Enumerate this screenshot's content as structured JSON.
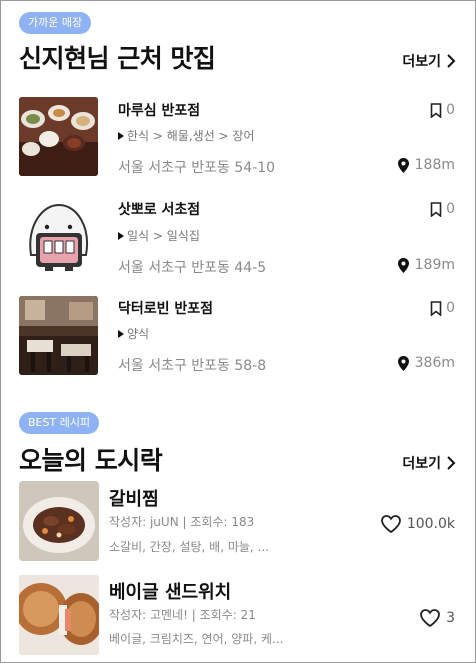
{
  "nearby": {
    "badge": "가까운 매장",
    "title": "신지현님 근처 맛집",
    "more": "더보기",
    "items": [
      {
        "name": "마루심 반포점",
        "category": "한식 > 해물,생선 > 장어",
        "address": "서울 서초구 반포동 54-10",
        "bookmarks": "0",
        "distance": "188m"
      },
      {
        "name": "삿뽀로 서초점",
        "category": "일식 > 일식집",
        "address": "서울 서초구 반포동 44-5",
        "bookmarks": "0",
        "distance": "189m"
      },
      {
        "name": "닥터로빈 반포점",
        "category": "양식",
        "address": "서울 서초구 반포동 58-8",
        "bookmarks": "0",
        "distance": "386m"
      }
    ]
  },
  "lunchbox": {
    "badge": "BEST 레시피",
    "title": "오늘의 도시락",
    "more": "더보기",
    "items": [
      {
        "title": "갈비찜",
        "meta": "작성자: juUN | 조회수: 183",
        "ingredients": "소갈비, 간장, 설탕, 배, 마늘, ...",
        "likes": "100.0k"
      },
      {
        "title": "베이글 샌드위치",
        "meta": "작성자: 고멘네! | 조회수: 21",
        "ingredients": "베이글, 크림치즈, 연어, 양파, 케...",
        "likes": "3"
      }
    ]
  },
  "colors": {
    "badge": "#8fb2f4",
    "muted": "#8a8a8a"
  },
  "icons": [
    "chevron-right-icon",
    "bookmark-icon",
    "location-pin-icon",
    "heart-icon",
    "triangle-bullet-icon"
  ]
}
